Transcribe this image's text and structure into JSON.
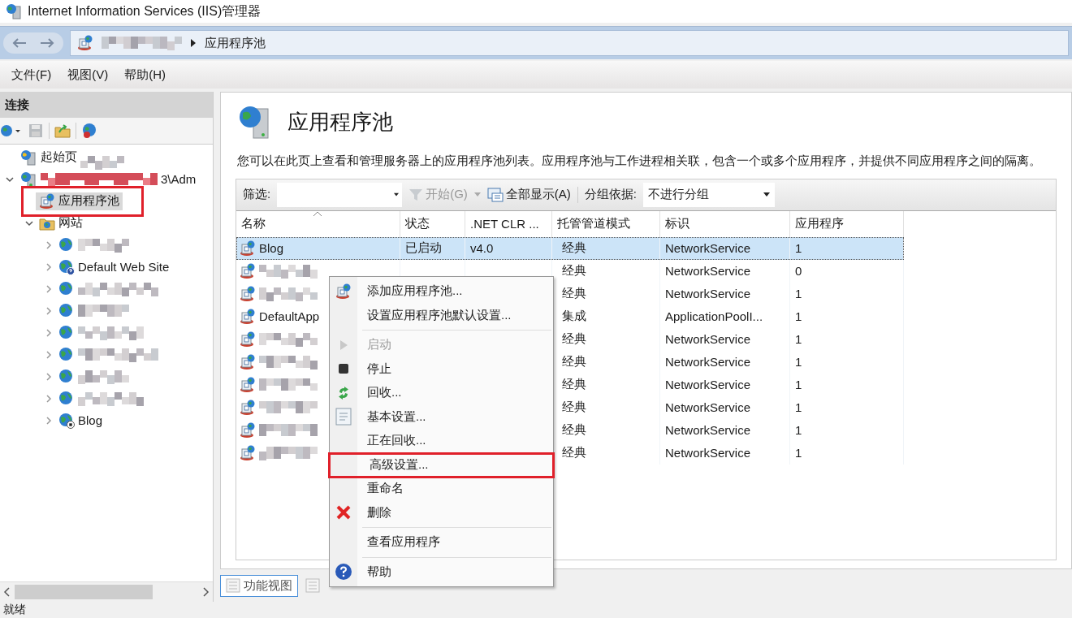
{
  "window": {
    "title": "Internet Information Services (IIS)管理器"
  },
  "address_bar": {
    "segments": [
      {
        "redacted": true
      },
      {
        "label": "应用程序池"
      }
    ]
  },
  "menu_bar": [
    "文件(F)",
    "视图(V)",
    "帮助(H)"
  ],
  "connections": {
    "title": "连接",
    "tree": [
      {
        "label": "起始页",
        "kind": "start",
        "redacted": true,
        "selected": false
      },
      {
        "label": "3\\Adm",
        "kind": "server",
        "redacted": true,
        "selected": false,
        "expanded": true,
        "children": [
          {
            "label": "应用程序池",
            "kind": "pools",
            "selected": true,
            "highlighted": true
          },
          {
            "label": "网站",
            "kind": "sites",
            "selected": false,
            "expanded": true,
            "children": [
              {
                "kind": "site",
                "redacted": true,
                "selected": false
              },
              {
                "label": "Default Web Site",
                "kind": "site-help",
                "selected": false
              },
              {
                "kind": "site",
                "redacted": true,
                "selected": false
              },
              {
                "kind": "site",
                "redacted": true,
                "selected": false
              },
              {
                "kind": "site",
                "redacted": true,
                "selected": false
              },
              {
                "kind": "site",
                "redacted": true,
                "selected": false
              },
              {
                "kind": "site",
                "redacted": true,
                "selected": false
              },
              {
                "kind": "site",
                "redacted": true,
                "selected": false
              },
              {
                "label": "Blog",
                "kind": "site-stopped",
                "selected": false
              }
            ]
          }
        ]
      }
    ]
  },
  "page": {
    "title": "应用程序池",
    "description": "您可以在此页上查看和管理服务器上的应用程序池列表。应用程序池与工作进程相关联，包含一个或多个应用程序，并提供不同应用程序之间的隔离。",
    "toolbar": {
      "filter_label": "筛选:",
      "go": {
        "label": "开始(G)",
        "disabled": true
      },
      "show_all": "全部显示(A)",
      "group_label": "分组依据:",
      "group_value": "不进行分组"
    },
    "columns": [
      "名称",
      "状态",
      ".NET CLR ...",
      "托管管道模式",
      "标识",
      "应用程序"
    ],
    "rows": [
      {
        "name": "Blog",
        "status": "已启动",
        "clr": "v4.0",
        "mode": "经典",
        "identity": "NetworkService",
        "apps": "1",
        "selected": true
      },
      {
        "redacted": true,
        "mode": "经典",
        "identity": "NetworkService",
        "apps": "0",
        "selected": false
      },
      {
        "redacted": true,
        "mode": "经典",
        "identity": "NetworkService",
        "apps": "1",
        "selected": false
      },
      {
        "name": "DefaultApp",
        "mode": "集成",
        "identity": "ApplicationPoolI...",
        "apps": "1",
        "selected": false
      },
      {
        "redacted": true,
        "mode": "经典",
        "identity": "NetworkService",
        "apps": "1",
        "selected": false
      },
      {
        "redacted": true,
        "mode": "经典",
        "identity": "NetworkService",
        "apps": "1",
        "selected": false
      },
      {
        "redacted": true,
        "mode": "经典",
        "identity": "NetworkService",
        "apps": "1",
        "selected": false
      },
      {
        "redacted": true,
        "mode": "经典",
        "identity": "NetworkService",
        "apps": "1",
        "selected": false
      },
      {
        "redacted": true,
        "mode": "经典",
        "identity": "NetworkService",
        "apps": "1",
        "selected": false
      },
      {
        "redacted": true,
        "mode": "经典",
        "identity": "NetworkService",
        "apps": "1",
        "selected": false
      }
    ]
  },
  "view_tabs": [
    {
      "label": "功能视图",
      "selected": true
    },
    {
      "selected": false
    }
  ],
  "context_menu": [
    {
      "kind": "add",
      "label": "添加应用程序池...",
      "disabled": false
    },
    {
      "kind": "plain",
      "label": "设置应用程序池默认设置...",
      "disabled": false
    },
    {
      "kind": "separator"
    },
    {
      "kind": "start",
      "label": "启动",
      "disabled": true
    },
    {
      "kind": "stop",
      "label": "停止",
      "disabled": false
    },
    {
      "kind": "recycle",
      "label": "回收...",
      "disabled": false
    },
    {
      "kind": "settings",
      "label": "基本设置...",
      "disabled": false
    },
    {
      "kind": "plain",
      "label": "正在回收...",
      "disabled": false
    },
    {
      "kind": "plain",
      "label": "高级设置...",
      "disabled": false,
      "highlighted": true
    },
    {
      "kind": "plain",
      "label": "重命名",
      "disabled": false
    },
    {
      "kind": "delete",
      "label": "删除",
      "disabled": false
    },
    {
      "kind": "separator"
    },
    {
      "kind": "plain",
      "label": "查看应用程序",
      "disabled": false
    },
    {
      "kind": "separator"
    },
    {
      "kind": "help",
      "label": "帮助",
      "disabled": false
    }
  ],
  "status_bar": "就绪"
}
